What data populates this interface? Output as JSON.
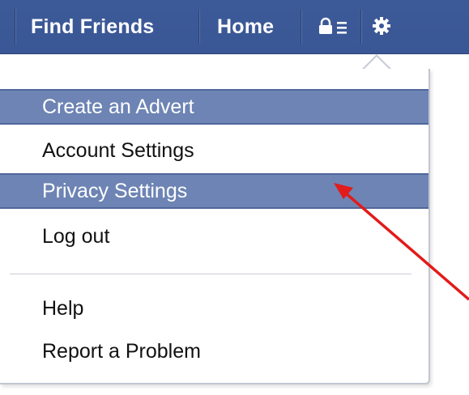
{
  "topbar": {
    "nav_links": [
      {
        "label": "Find Friends"
      },
      {
        "label": "Home"
      }
    ],
    "icons": {
      "privacy_shortcuts": "lock-list-icon",
      "account_menu": "gear-icon"
    },
    "colors": {
      "bar": "#3b5998",
      "highlight": "#6d84b4"
    }
  },
  "dropdown": {
    "items": [
      {
        "label": "Create an Advert",
        "highlighted": true
      },
      {
        "label": "Account Settings",
        "highlighted": false
      },
      {
        "label": "Privacy Settings",
        "highlighted": true
      },
      {
        "label": "Log out",
        "highlighted": false
      },
      {
        "label": "Help",
        "highlighted": false
      },
      {
        "label": "Report a Problem",
        "highlighted": false
      }
    ]
  },
  "annotation": {
    "arrow_color": "#e21b1b"
  }
}
